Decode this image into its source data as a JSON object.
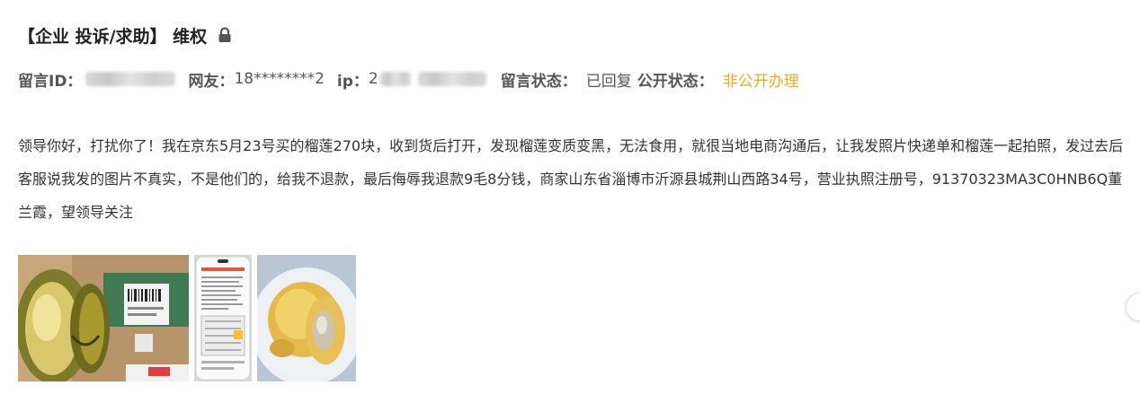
{
  "post": {
    "title": "【企业 投诉/求助】 维权",
    "lock_icon": "lock-icon"
  },
  "meta": {
    "id_label": "留言ID：",
    "user_label": "网友：",
    "user_value": "18********2",
    "ip_label": "ip：",
    "ip_prefix": "2",
    "status_label": "留言状态：",
    "status_value": "已回复",
    "public_label": "公开状态：",
    "public_value": "非公开办理",
    "public_color": "#f5a623"
  },
  "content": {
    "text": "领导你好，打扰你了！我在京东5月23号买的榴莲270块，收到货后打开，发现榴莲变质变黑，无法食用，就很当地电商沟通后，让我发照片快递单和榴莲一起拍照，发过去后客服说我发的图片不真实，不是他们的，给我不退款，最后侮辱我退款9毛8分钱，商家山东省淄博市沂源县城荆山西路34号，营业执照注册号，91370323MA3C0HNB6Q董兰霞，望领导关注"
  },
  "images": [
    {
      "name": "durian-parcel-photo"
    },
    {
      "name": "phone-screenshot-photo"
    },
    {
      "name": "durian-flesh-photo"
    }
  ]
}
